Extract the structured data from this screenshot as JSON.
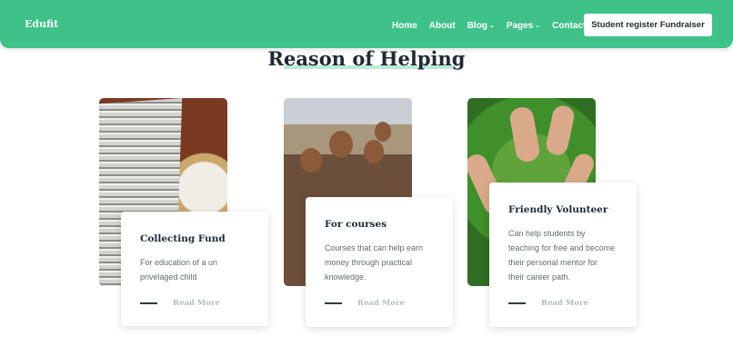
{
  "nav": {
    "brand": "Edufit",
    "links": [
      "Home",
      "About",
      "Blog",
      "Pages",
      "Contact"
    ],
    "dropdown_chevron": "⌄",
    "cta": "Student register Fundraiser"
  },
  "section": {
    "title": "Reason of Helping"
  },
  "cards": [
    {
      "title": "Collecting Fund",
      "desc_lines": [
        "For education of a un",
        "privelaged child"
      ],
      "more": "Read More",
      "image_icon": "coins-image"
    },
    {
      "title": "For courses",
      "desc_lines": [
        "Courses that can help earn",
        "money through practical",
        "knowledge."
      ],
      "more": "Read More",
      "image_icon": "children-image"
    },
    {
      "title": "Friendly Volunteer",
      "desc_lines": [
        "Can help students by",
        "teaching for free and become",
        "their personal mentor for",
        "their career path."
      ],
      "more": "Read More",
      "image_icon": "hands-image"
    }
  ],
  "colors": {
    "accent": "#3ec28a",
    "heading": "#1f2a34",
    "underline": "#b9ead5"
  }
}
